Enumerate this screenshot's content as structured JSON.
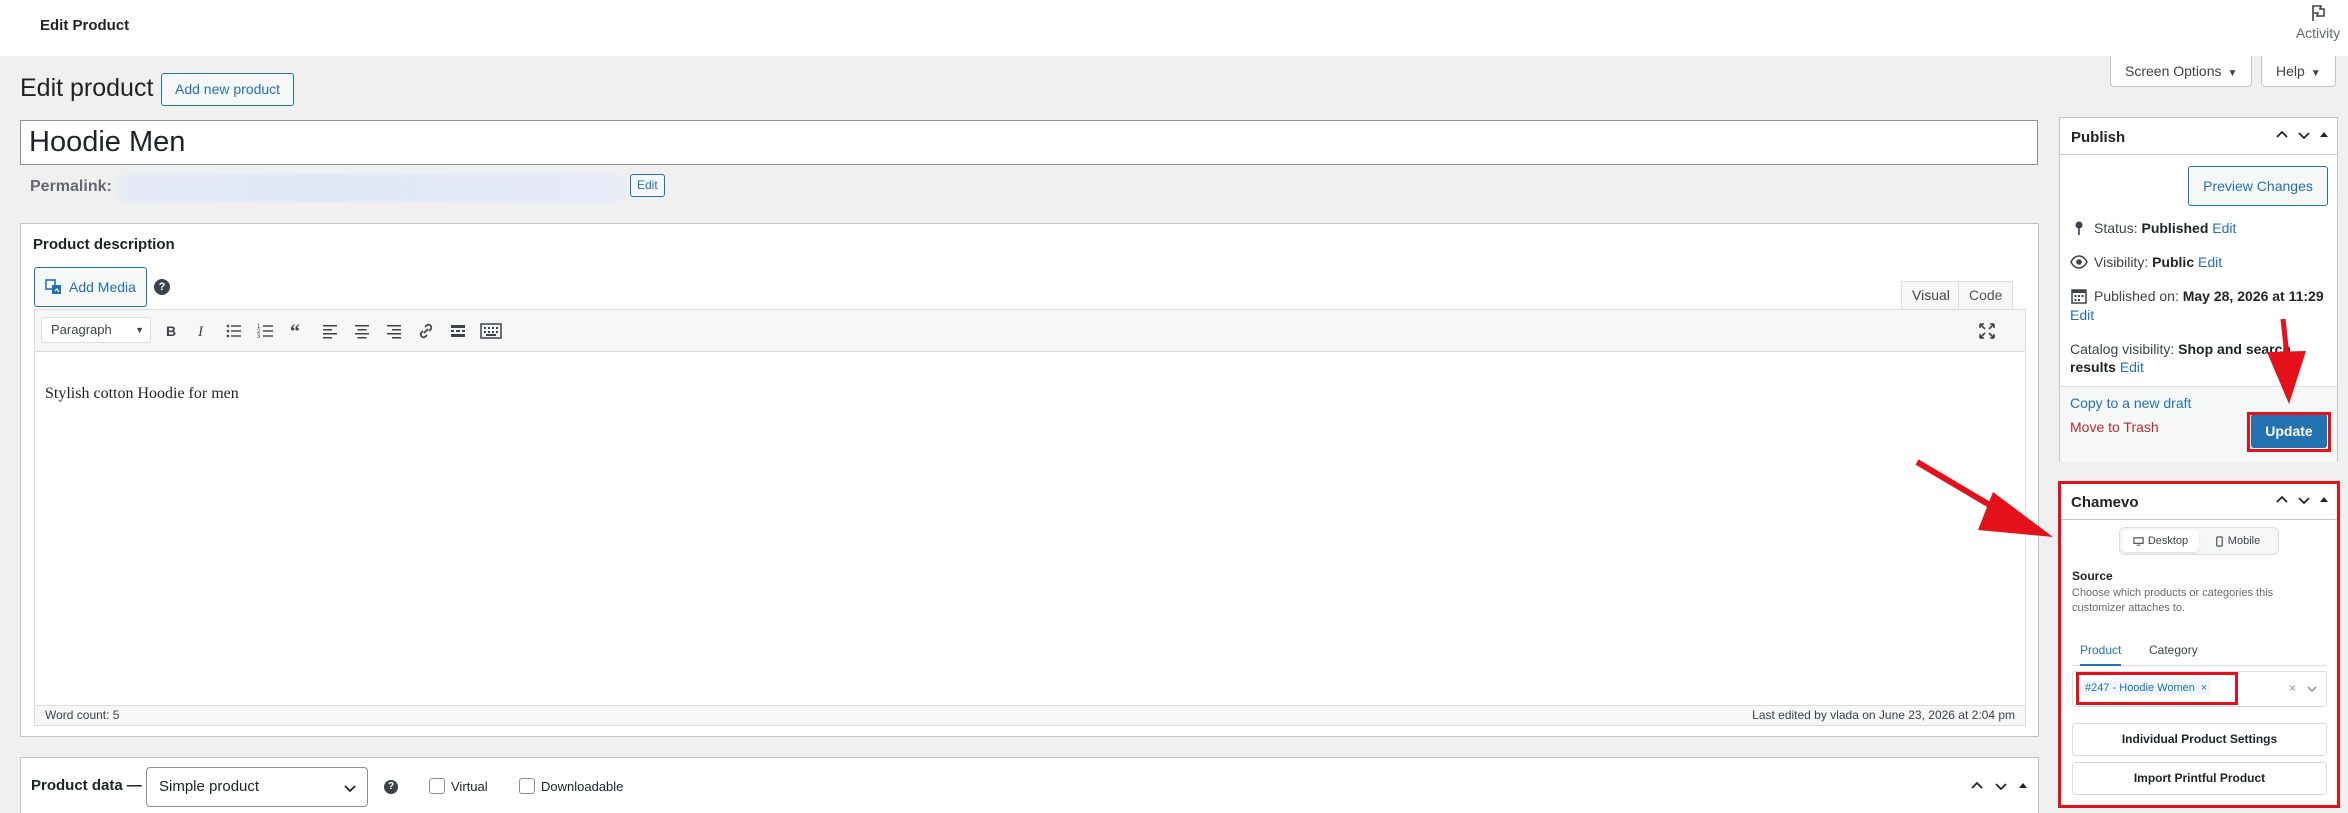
{
  "topbar": {
    "title": "Edit Product",
    "activity_label": "Activity"
  },
  "screen_options": {
    "screen_options_label": "Screen Options",
    "help_label": "Help"
  },
  "heading": {
    "title": "Edit product",
    "add_new_label": "Add new product"
  },
  "product": {
    "title": "Hoodie Men",
    "permalink_label": "Permalink:",
    "permalink_edit_label": "Edit"
  },
  "description": {
    "heading": "Product description",
    "add_media_label": "Add Media",
    "help_glyph": "?",
    "tabs": {
      "visual": "Visual",
      "code": "Code"
    },
    "format_select": "Paragraph",
    "content": "Stylish cotton Hoodie for men",
    "word_count": "Word count: 5",
    "last_edited": "Last edited by vlada on June 23, 2026 at 2:04 pm"
  },
  "product_data": {
    "label": "Product data —",
    "type": "Simple product",
    "virtual_label": "Virtual",
    "downloadable_label": "Downloadable"
  },
  "publish": {
    "heading": "Publish",
    "preview_label": "Preview Changes",
    "status_label": "Status:",
    "status_value": "Published",
    "visibility_label": "Visibility:",
    "visibility_value": "Public",
    "published_on_label": "Published on:",
    "published_on_value": "May 28, 2026 at 11:29",
    "catalog_label": "Catalog visibility:",
    "catalog_value": "Shop and search",
    "catalog_value_2": "results",
    "edit_label": "Edit",
    "copy_draft_label": "Copy to a new draft",
    "trash_label": "Move to Trash",
    "update_label": "Update"
  },
  "chamevo": {
    "heading": "Chamevo",
    "device_desktop": "Desktop",
    "device_mobile": "Mobile",
    "source_title": "Source",
    "source_desc": "Choose which products or categories this customizer attaches to.",
    "tab_product": "Product",
    "tab_category": "Category",
    "selected_token": "#247 - Hoodie Women",
    "token_remove": "×",
    "clear_glyph": "×",
    "individual_settings_label": "Individual Product Settings",
    "import_printful_label": "Import Printful Product"
  },
  "colors": {
    "accent": "#2271b1",
    "update_bg": "#2271b1",
    "annotation_red": "#e4111b",
    "trash_red": "#b32d2e"
  }
}
